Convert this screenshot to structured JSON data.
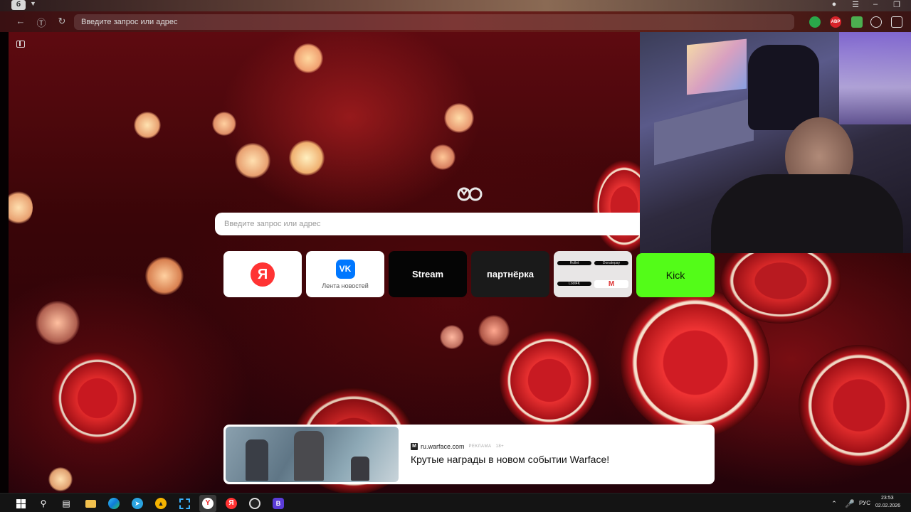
{
  "browser": {
    "tab_icon_letter": "б",
    "omnibox_placeholder": "Введите запрос или адрес",
    "extensions": [
      {
        "name": "shield",
        "color": "#2aa84a"
      },
      {
        "name": "adblock-plus",
        "label": "ABP",
        "color": "#d8232a"
      },
      {
        "name": "download",
        "color": "#4caf50"
      }
    ]
  },
  "newtab": {
    "search_placeholder": "Введите запрос или адрес",
    "tiles": {
      "yandex_letter": "Я",
      "vk_letters": "VK",
      "vk_label": "Лента новостей",
      "stream_label": "Stream",
      "partner_label": "партнёрка",
      "group_items": [
        "Rollet",
        "Donatepay",
        "Loot4K",
        "M"
      ],
      "kick_label": "Kick"
    },
    "ad": {
      "domain": "ru.warface.com",
      "tag": "РЕКЛАМА",
      "age": "18+",
      "title": "Крутые награды в новом событии Warface!"
    }
  },
  "taskbar": {
    "lang": "РУС",
    "time": "23:53",
    "date": "02.02.2026",
    "vk_app_letter": "В"
  }
}
